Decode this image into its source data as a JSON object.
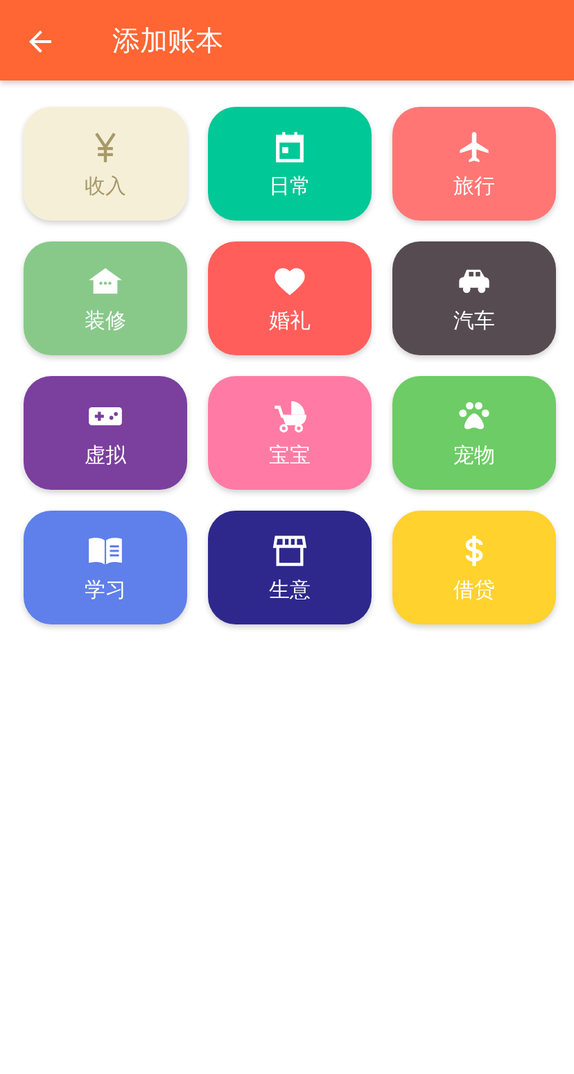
{
  "header": {
    "title": "添加账本"
  },
  "books": [
    {
      "label": "收入",
      "kind": "yen",
      "color": "#f6efd8"
    },
    {
      "label": "日常",
      "kind": "calendar",
      "color": "#00c896"
    },
    {
      "label": "旅行",
      "kind": "plane",
      "color": "#ff7675"
    },
    {
      "label": "装修",
      "kind": "house",
      "color": "#88c98a"
    },
    {
      "label": "婚礼",
      "kind": "heart",
      "color": "#ff5e5b"
    },
    {
      "label": "汽车",
      "kind": "car",
      "color": "#564b50"
    },
    {
      "label": "虚拟",
      "kind": "gamepad",
      "color": "#7b3f9e"
    },
    {
      "label": "宝宝",
      "kind": "stroller",
      "color": "#ff7ba6"
    },
    {
      "label": "宠物",
      "kind": "paw",
      "color": "#6dcc66"
    },
    {
      "label": "学习",
      "kind": "book",
      "color": "#5f7fea"
    },
    {
      "label": "生意",
      "kind": "store",
      "color": "#2e288c"
    },
    {
      "label": "借贷",
      "kind": "dollar",
      "color": "#ffd22e"
    }
  ]
}
